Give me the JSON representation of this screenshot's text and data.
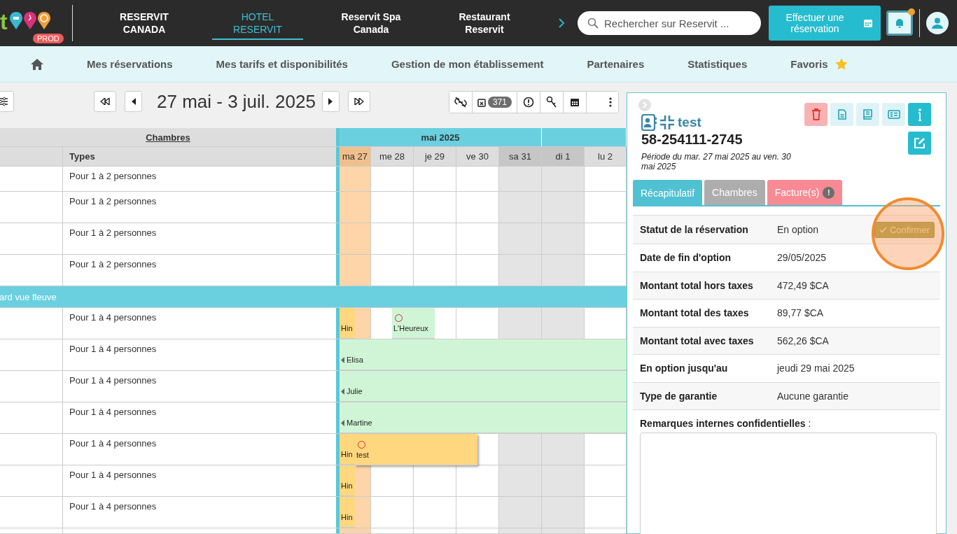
{
  "topbar": {
    "logo_text": "t",
    "env_badge": "PROD",
    "apps": [
      {
        "label": "RESERVIT CANADA",
        "selected": false
      },
      {
        "label": "HOTEL RESERVIT",
        "selected": true
      },
      {
        "label": "Reservit Spa Canada",
        "selected": false
      },
      {
        "label": "Restaurant Reservit",
        "selected": false
      }
    ],
    "search": {
      "placeholder": "Rechercher sur Reservit ..."
    },
    "book_button": "Effectuer une réservation",
    "notification": true
  },
  "menu": {
    "items": [
      "Mes réservations",
      "Mes tarifs et disponibilités",
      "Gestion de mon établissement",
      "Partenaires",
      "Statistiques",
      "Favoris"
    ]
  },
  "toolbar": {
    "date_range": "27 mai - 3 juil. 2025",
    "cancelled_count": "371"
  },
  "planning": {
    "group_header": "Chambres",
    "types_header": "Types",
    "month": "mai 2025",
    "days": [
      {
        "label": "ma 27",
        "today": true,
        "weekend": false
      },
      {
        "label": "me 28",
        "today": false,
        "weekend": false
      },
      {
        "label": "je 29",
        "today": false,
        "weekend": false
      },
      {
        "label": "ve 30",
        "today": false,
        "weekend": false
      },
      {
        "label": "sa 31",
        "today": false,
        "weekend": true
      },
      {
        "label": "di 1",
        "today": false,
        "weekend": true
      },
      {
        "label": "lu 2",
        "today": false,
        "weekend": false
      }
    ],
    "rows": [
      {
        "kind": "room",
        "type": "Pour 1 à 2 personnes",
        "bookings": []
      },
      {
        "kind": "room",
        "type": "Pour 1 à 2 personnes",
        "bookings": []
      },
      {
        "kind": "room",
        "type": "Pour 1 à 2 personnes",
        "bookings": []
      },
      {
        "kind": "room",
        "type": "Pour 1 à 2 personnes",
        "bookings": []
      },
      {
        "kind": "category",
        "label": "ard vue fleuve"
      },
      {
        "kind": "room",
        "type": "Pour 1 à 4 personnes",
        "bookings": [
          {
            "name": "Hin",
            "color": "#ffd77f",
            "marker": false,
            "continued": false,
            "selected": false
          },
          {
            "name": "L'Heureux",
            "color": "#d0f5d6",
            "marker": true,
            "continued": false,
            "selected": false
          }
        ]
      },
      {
        "kind": "room",
        "type": "Pour 1 à 4 personnes",
        "bookings": [
          {
            "name": "Elisa",
            "color": "#d0f5d6",
            "marker": false,
            "continued": true,
            "selected": false
          }
        ]
      },
      {
        "kind": "room",
        "type": "Pour 1 à 4 personnes",
        "bookings": [
          {
            "name": "Julie",
            "color": "#d0f5d6",
            "marker": false,
            "continued": true,
            "selected": false
          }
        ]
      },
      {
        "kind": "room",
        "type": "Pour 1 à 4 personnes",
        "bookings": [
          {
            "name": "Martine",
            "color": "#d0f5d6",
            "marker": false,
            "continued": true,
            "selected": false
          }
        ]
      },
      {
        "kind": "room",
        "type": "Pour 1 à 4 personnes",
        "bookings": [
          {
            "name": "Hin",
            "color": "#ffd77f",
            "marker": false,
            "continued": false,
            "selected": false
          },
          {
            "name": "test",
            "color": "#ffd77f",
            "marker": true,
            "continued": false,
            "selected": true
          }
        ]
      },
      {
        "kind": "room",
        "type": "Pour 1 à 4 personnes",
        "bookings": [
          {
            "name": "Hin",
            "color": "#ffd77f",
            "marker": false,
            "continued": false,
            "selected": false
          }
        ]
      },
      {
        "kind": "room",
        "type": "Pour 1 à 4 personnes",
        "bookings": [
          {
            "name": "Hin",
            "color": "#ffd77f",
            "marker": false,
            "continued": false,
            "selected": false
          }
        ]
      }
    ]
  },
  "reservation": {
    "name": "test",
    "number": "58-254111-2745",
    "period": "Période du mar. 27 mai 2025 au ven. 30 mai 2025",
    "tabs": [
      {
        "label": "Récapitulatif",
        "selected": true,
        "color": "#4fc1d3"
      },
      {
        "label": "Chambres",
        "selected": false,
        "color": "#a9a9a9"
      },
      {
        "label": "Facture(s)",
        "selected": false,
        "color": "#f7848e",
        "alert": "!"
      }
    ],
    "summary": [
      {
        "label": "Statut de la réservation",
        "value": "En option",
        "action": "Confirmer",
        "highlighted": true
      },
      {
        "label": "Date de fin d'option",
        "value": "29/05/2025"
      },
      {
        "label": "Montant total hors taxes",
        "value": "472,49 $CA"
      },
      {
        "label": "Montant total des taxes",
        "value": "89,77 $CA"
      },
      {
        "label": "Montant total avec taxes",
        "value": "562,26 $CA"
      },
      {
        "label": "En option jusqu'au",
        "value": "jeudi 29 mai 2025"
      },
      {
        "label": "Type de garantie",
        "value": "Aucune garantie"
      }
    ],
    "remarks_label": "**Remarques internes confidentielles** :"
  }
}
